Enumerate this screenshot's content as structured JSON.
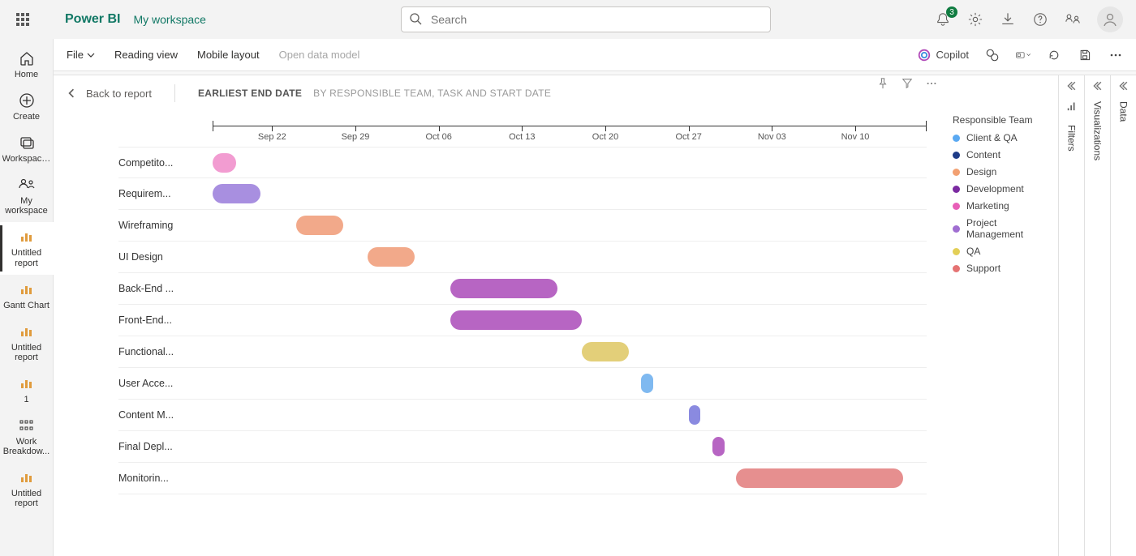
{
  "header": {
    "brand": "Power BI",
    "workspace": "My workspace",
    "search_placeholder": "Search",
    "notification_count": "3"
  },
  "leftnav": {
    "home": "Home",
    "create": "Create",
    "workspaces": "Workspaces",
    "myworkspace": "My workspace",
    "reports": [
      "Untitled report",
      "Gantt Chart",
      "Untitled report",
      "1",
      "Work Breakdow...",
      "Untitled report"
    ]
  },
  "toolbar": {
    "file": "File",
    "reading": "Reading view",
    "mobile": "Mobile layout",
    "opendata": "Open data model",
    "copilot": "Copilot"
  },
  "panes": {
    "filters": "Filters",
    "visualizations": "Visualizations",
    "data": "Data"
  },
  "report": {
    "back": "Back to report",
    "title": "EARLIEST END DATE",
    "subtitle": "BY RESPONSIBLE TEAM, TASK AND START DATE"
  },
  "legend": {
    "title": "Responsible Team",
    "items": [
      {
        "label": "Client & QA",
        "color": "#5aa9f2"
      },
      {
        "label": "Content",
        "color": "#1f3c88"
      },
      {
        "label": "Design",
        "color": "#f2a072"
      },
      {
        "label": "Development",
        "color": "#7b2aa1"
      },
      {
        "label": "Marketing",
        "color": "#e85fb8"
      },
      {
        "label": "Project Management",
        "color": "#a06ed1"
      },
      {
        "label": "QA",
        "color": "#e3cf57"
      },
      {
        "label": "Support",
        "color": "#e57373"
      }
    ]
  },
  "chart_data": {
    "type": "gantt",
    "x_axis": {
      "min": "2024-09-17",
      "max": "2024-11-16",
      "ticks": [
        "Sep 22",
        "Sep 29",
        "Oct 06",
        "Oct 13",
        "Oct 20",
        "Oct 27",
        "Nov 03",
        "Nov 10"
      ]
    },
    "tasks": [
      {
        "label": "Competito...",
        "team": "Marketing",
        "color": "#f29cd1",
        "start": "2024-09-17",
        "end": "2024-09-19"
      },
      {
        "label": "Requirem...",
        "team": "Project Management",
        "color": "#a88fe0",
        "start": "2024-09-17",
        "end": "2024-09-21"
      },
      {
        "label": "Wireframing",
        "team": "Design",
        "color": "#f2a98a",
        "start": "2024-09-24",
        "end": "2024-09-28"
      },
      {
        "label": "UI Design",
        "team": "Design",
        "color": "#f2a98a",
        "start": "2024-09-30",
        "end": "2024-10-04"
      },
      {
        "label": "Back-End ...",
        "team": "Development",
        "color": "#b765c3",
        "start": "2024-10-07",
        "end": "2024-10-16"
      },
      {
        "label": "Front-End...",
        "team": "Development",
        "color": "#b765c3",
        "start": "2024-10-07",
        "end": "2024-10-18"
      },
      {
        "label": "Functional...",
        "team": "QA",
        "color": "#e3cf79",
        "start": "2024-10-18",
        "end": "2024-10-22"
      },
      {
        "label": "User Acce...",
        "team": "Client & QA",
        "color": "#7fb9f0",
        "start": "2024-10-23",
        "end": "2024-10-24"
      },
      {
        "label": "Content M...",
        "team": "Content",
        "color": "#8a8ae0",
        "start": "2024-10-27",
        "end": "2024-10-28"
      },
      {
        "label": "Final Depl...",
        "team": "Development",
        "color": "#b765c3",
        "start": "2024-10-29",
        "end": "2024-10-30"
      },
      {
        "label": "Monitorin...",
        "team": "Support",
        "color": "#e68f8f",
        "start": "2024-10-31",
        "end": "2024-11-14"
      }
    ]
  }
}
